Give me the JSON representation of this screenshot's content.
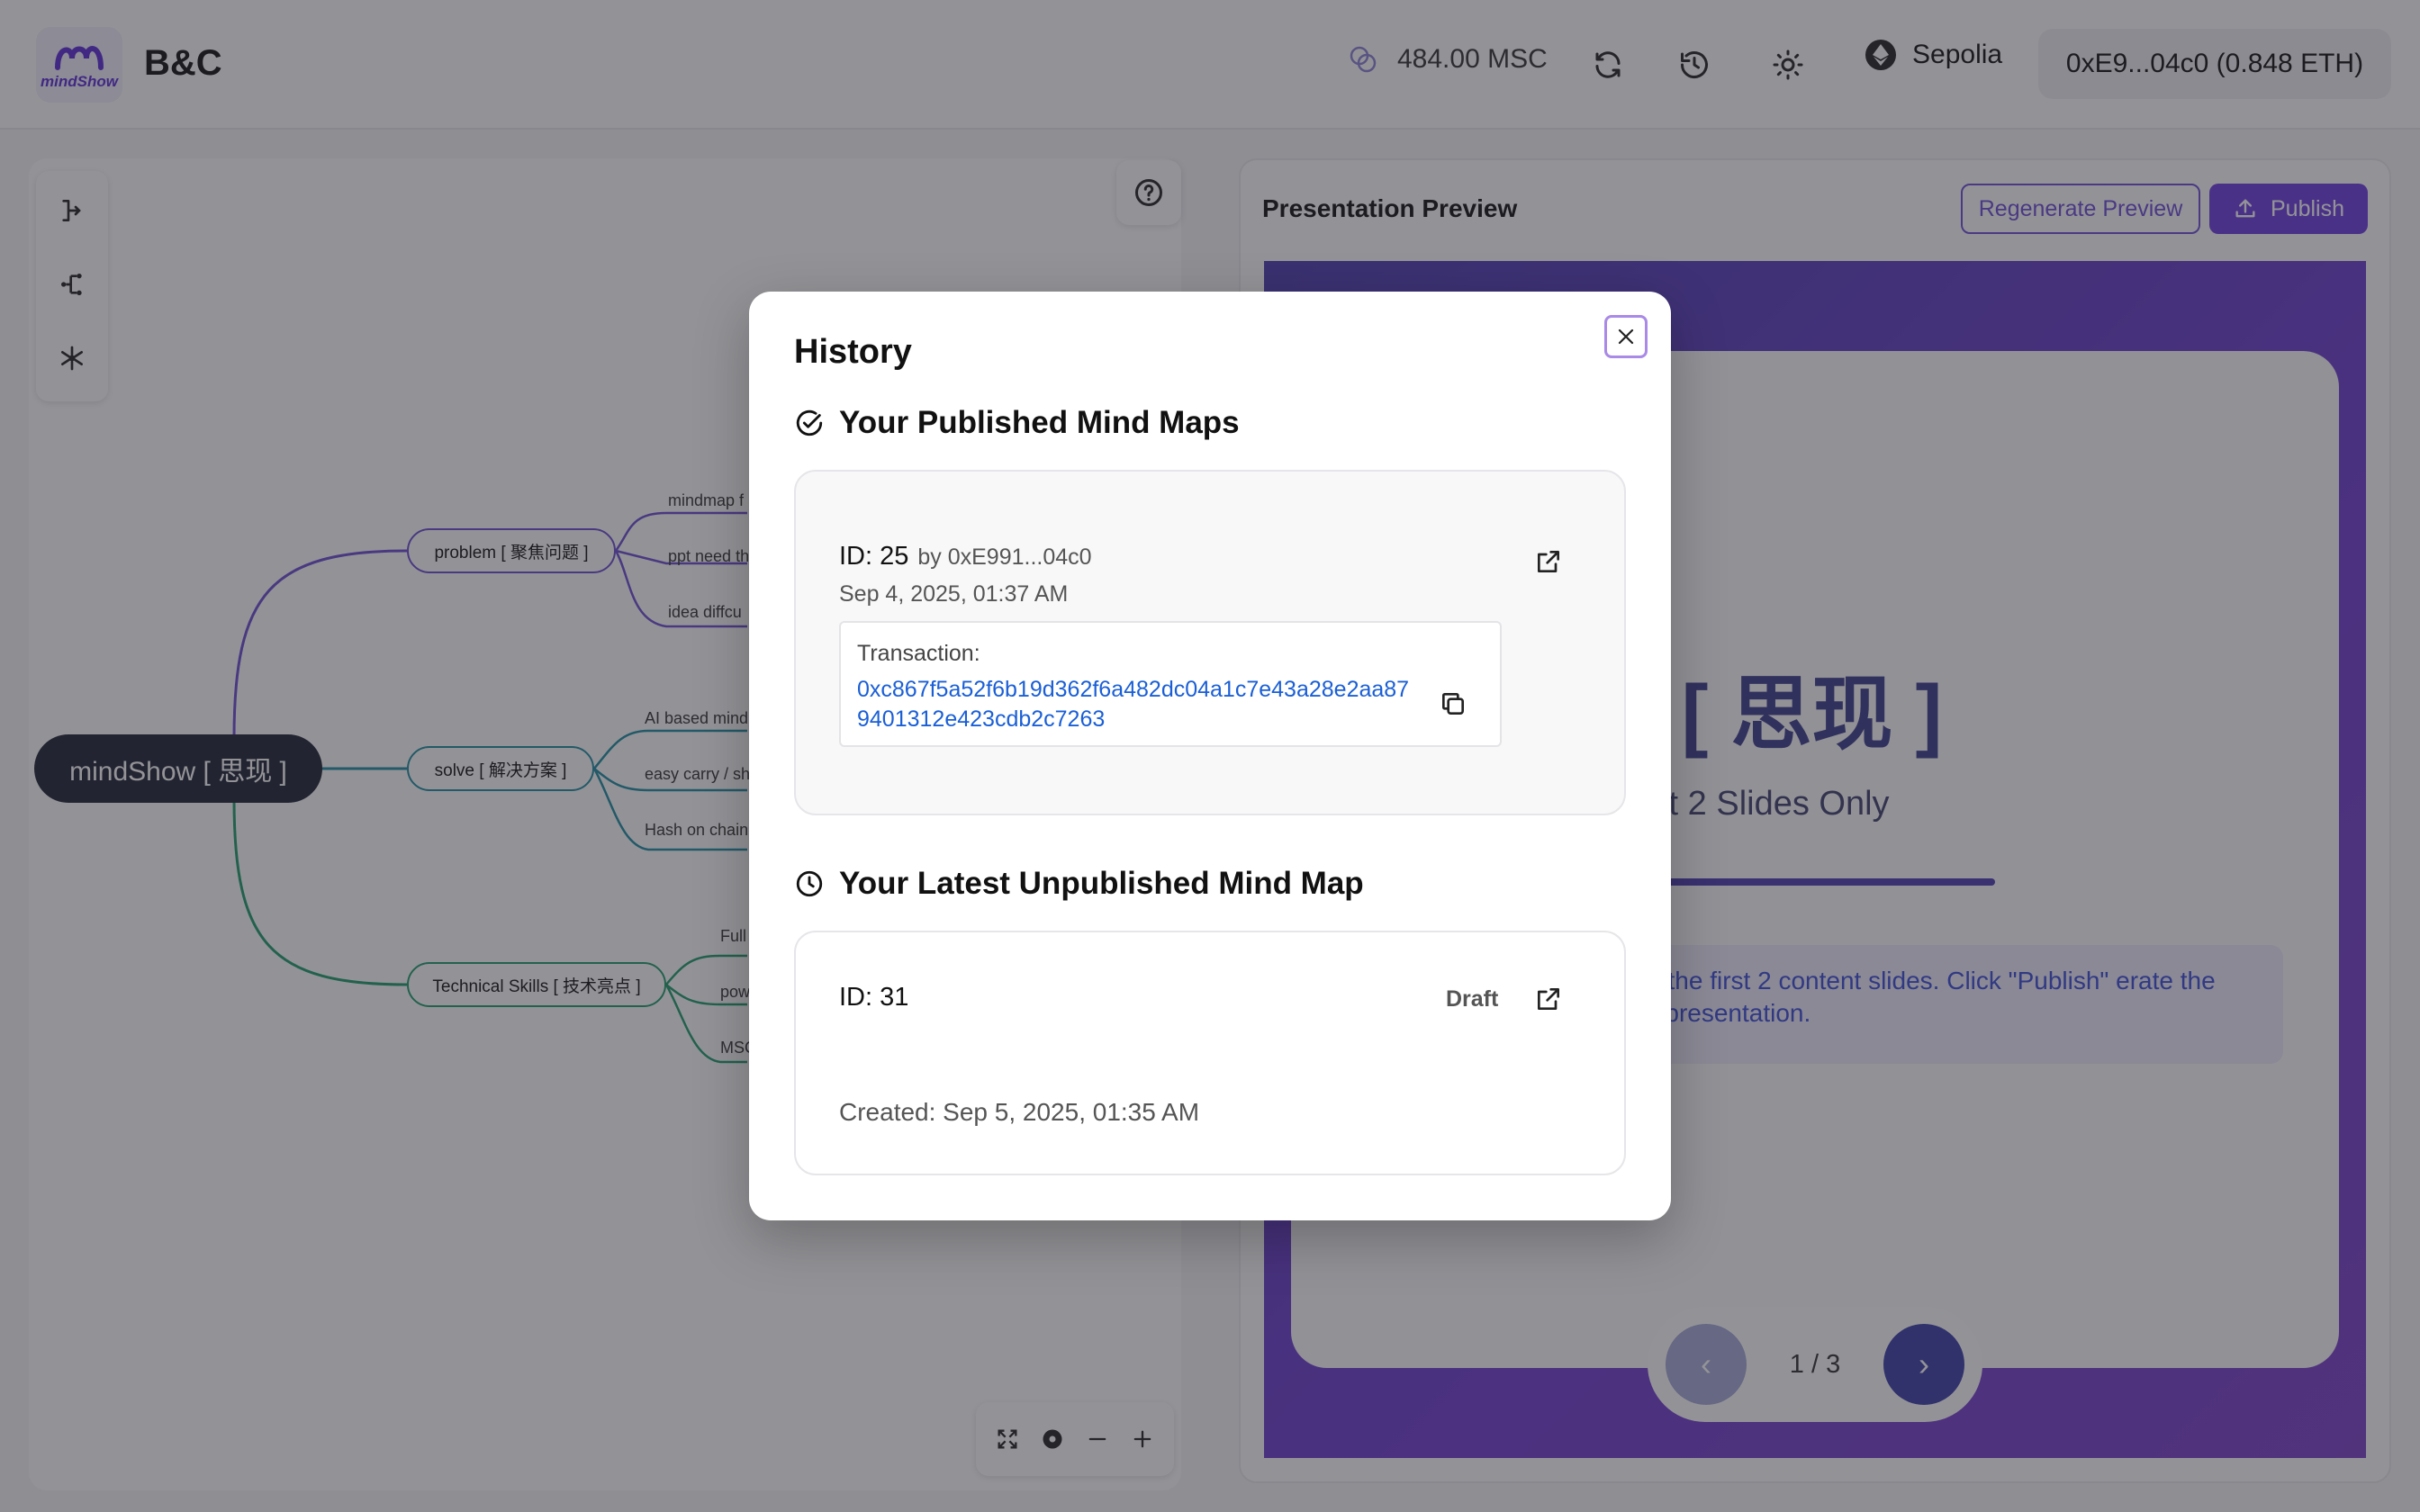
{
  "header": {
    "app_name": "B&C",
    "logo_text": "mindShow",
    "balance": "484.00 MSC",
    "network": "Sepolia",
    "wallet": "0xE9...04c0 (0.848 ETH)"
  },
  "mindmap": {
    "root": "mindShow [ 思现 ]",
    "branches": [
      {
        "label": "problem [ 聚焦问题 ]",
        "leaves": [
          "mindmap f",
          "ppt need th",
          "idea diffcu"
        ]
      },
      {
        "label": "solve [ 解决方案 ]",
        "leaves": [
          "AI based mind",
          "easy carry / sh",
          "Hash on chain"
        ]
      },
      {
        "label": "Technical Skills [ 技术亮点 ]",
        "leaves": [
          "Full",
          "pow",
          "MSC"
        ]
      }
    ]
  },
  "preview": {
    "title": "Presentation Preview",
    "regenerate_label": "Regenerate Preview",
    "publish_label": "Publish",
    "slide_title": "Show [ 思现 ]",
    "slide_subtitle": "Mode - First 2 Slides Only",
    "slide_note": "wing only the first 2 content slides. Click \"Publish\" erate the complete presentation.",
    "page_indicator": "1 / 3",
    "prev_symbol": "‹",
    "next_symbol": "›"
  },
  "modal": {
    "title": "History",
    "published_heading": "Your Published Mind Maps",
    "published_item": {
      "id": "ID: 25",
      "by": "by 0xE991...04c0",
      "date": "Sep 4, 2025, 01:37 AM",
      "tx_label": "Transaction:",
      "tx_hash": "0xc867f5a52f6b19d362f6a482dc04a1c7e43a28e2aa879401312e423cdb2c7263"
    },
    "unpublished_heading": "Your Latest Unpublished Mind Map",
    "unpublished_item": {
      "id": "ID: 31",
      "status": "Draft",
      "created": "Created: Sep 5, 2025, 01:35 AM"
    }
  },
  "colors": {
    "accent": "#6d3be0",
    "problem_branch": "#6a4bd1",
    "solve_branch": "#1e8aa0",
    "skills_branch": "#1f9a6a",
    "link": "#1a5fd6"
  },
  "icons": [
    "coins-icon",
    "refresh-icon",
    "history-icon",
    "sun-icon",
    "ethereum-icon",
    "close-icon",
    "check-circle-icon",
    "clock-icon",
    "external-link-icon",
    "copy-icon",
    "help-icon",
    "fullscreen-icon",
    "locate-icon",
    "zoom-out-icon",
    "zoom-in-icon",
    "upload-icon"
  ]
}
